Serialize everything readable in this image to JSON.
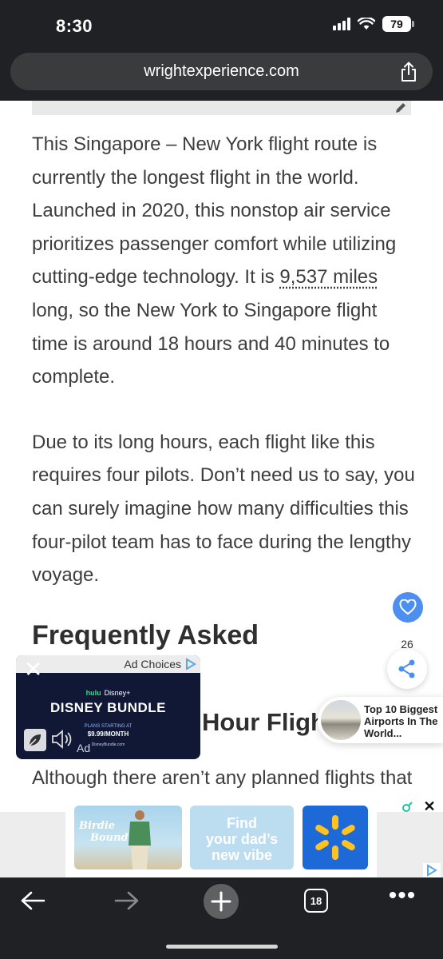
{
  "status_bar": {
    "time": "8:30",
    "battery": "79"
  },
  "url_bar": {
    "url": "wrightexperience.com"
  },
  "article": {
    "para1_before": "This Singapore – New York flight route is currently the longest flight in the world. Launched in 2020, this nonstop air service prioritizes passenger comfort while utilizing cutting-edge technology. It is ",
    "para1_highlight": "9,537 miles",
    "para1_after": " long, so the New York to Singapore flight time is around 18 hours and 40 minutes to complete.",
    "para2": "Due to its long hours, each flight like this requires four pilots. Don’t need us to say, you can surely imagine how many difficulties this four-pilot team has to face during the lengthy voyage.",
    "faq_heading": "Frequently Asked",
    "sub_heading_visible": "Hour Fligh",
    "para3": "Although there aren’t any planned flights that"
  },
  "side_widgets": {
    "like_count": "26"
  },
  "video_ad": {
    "ad_choices": "Ad Choices",
    "brand_line_hulu": "hulu",
    "brand_line_disney": "Disney+",
    "title": "DISNEY BUNDLE",
    "plans_line": "PLANS STARTING AT",
    "price": "$9.99/MONTH",
    "site": "DisneyBundle.com",
    "ad_tag": "Ad"
  },
  "recommendation": {
    "title": "Top 10 Biggest Airports In The World..."
  },
  "banner_ad": {
    "tile1_line1": "Birdie",
    "tile1_line2": "Bound",
    "tile2_line1": "Find",
    "tile2_line2": "your dad’s",
    "tile2_line3": "new vibe"
  },
  "toolbar": {
    "tabs_count": "18"
  },
  "colors": {
    "chrome": "#202124",
    "accent_blue": "#4c8ff0",
    "walmart_blue": "#1e69d8",
    "walmart_yellow": "#ffc220"
  }
}
